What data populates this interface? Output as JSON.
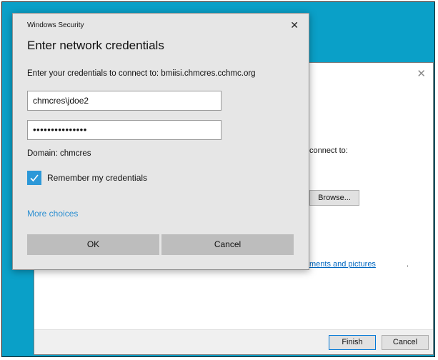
{
  "dialog": {
    "caption": "Windows Security",
    "title": "Enter network credentials",
    "description": "Enter your credentials to connect to: bmiisi.chmcres.cchmc.org",
    "username_value": "chmcres\\jdoe2",
    "password_value": "•••••••••••••••",
    "domain_text": "Domain: chmcres",
    "remember_label": "Remember my credentials",
    "remember_checked": true,
    "more_choices": "More choices",
    "ok_label": "OK",
    "cancel_label": "Cancel",
    "accent_color": "#2c98d8",
    "link_color": "#2c8fd1"
  },
  "wizard": {
    "connect_fragment": "connect to:",
    "browse_label": "Browse...",
    "link_fragment": "ments and pictures",
    "link_suffix": ".",
    "finish_label": "Finish",
    "cancel_label": "Cancel"
  },
  "icons": {
    "dialog_close": "close-icon",
    "wizard_close": "close-icon",
    "checkmark": "checkmark-icon"
  },
  "desktop_color": "#0aa0c8"
}
